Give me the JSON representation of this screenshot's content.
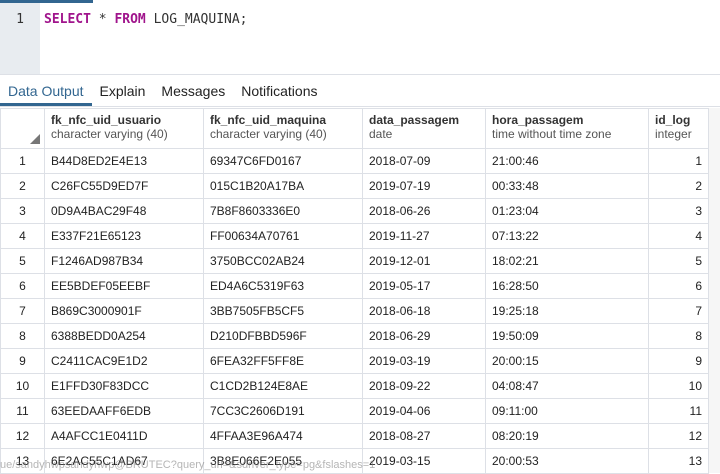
{
  "editor": {
    "line": "1",
    "kw1": "SELECT",
    "star": " * ",
    "kw2": "FROM",
    "rest": " LOG_MAQUINA;"
  },
  "tabs": [
    "Data Output",
    "Explain",
    "Messages",
    "Notifications"
  ],
  "columns": [
    {
      "name": "fk_nfc_uid_usuario",
      "type": "character varying (40)"
    },
    {
      "name": "fk_nfc_uid_maquina",
      "type": "character varying (40)"
    },
    {
      "name": "data_passagem",
      "type": "date"
    },
    {
      "name": "hora_passagem",
      "type": "time without time zone"
    },
    {
      "name": "id_log",
      "type": "integer"
    }
  ],
  "rows": [
    [
      "1",
      "B44D8ED2E4E13",
      "69347C6FD0167",
      "2018-07-09",
      "21:00:46",
      "1"
    ],
    [
      "2",
      "C26FC55D9ED7F",
      "015C1B20A17BA",
      "2019-07-19",
      "00:33:48",
      "2"
    ],
    [
      "3",
      "0D9A4BAC29F48",
      "7B8F8603336E0",
      "2018-06-26",
      "01:23:04",
      "3"
    ],
    [
      "4",
      "E337F21E65123",
      "FF00634A70761",
      "2019-11-27",
      "07:13:22",
      "4"
    ],
    [
      "5",
      "F1246AD987B34",
      "3750BCC02AB24",
      "2019-12-01",
      "18:02:21",
      "5"
    ],
    [
      "6",
      "EE5BDEF05EEBF",
      "ED4A6C5319F63",
      "2019-05-17",
      "16:28:50",
      "6"
    ],
    [
      "7",
      "B869C3000901F",
      "3BB7505FB5CF5",
      "2018-06-18",
      "19:25:18",
      "7"
    ],
    [
      "8",
      "6388BEDD0A254",
      "D210DFBBD596F",
      "2018-06-29",
      "19:50:09",
      "8"
    ],
    [
      "9",
      "C2411CAC9E1D2",
      "6FEA32FF5FF8E",
      "2019-03-19",
      "20:00:15",
      "9"
    ],
    [
      "10",
      "E1FFD30F83DCC",
      "C1CD2B124E8AE",
      "2018-09-22",
      "04:08:47",
      "10"
    ],
    [
      "11",
      "63EEDAAFF6EDB",
      "7CC3C2606D191",
      "2019-04-06",
      "09:11:00",
      "11"
    ],
    [
      "12",
      "A4AFCC1E0411D",
      "4FFAA3E96A474",
      "2018-08-27",
      "08:20:19",
      "12"
    ],
    [
      "13",
      "6E2AC55C1AD67",
      "3B8E066E2E055",
      "2019-03-15",
      "20:00:53",
      "13"
    ]
  ],
  "status_url": "ue/sandyhwpsandyhwp@BRUTEC?query_url=&sdriver_type=pg&fslashes=1"
}
